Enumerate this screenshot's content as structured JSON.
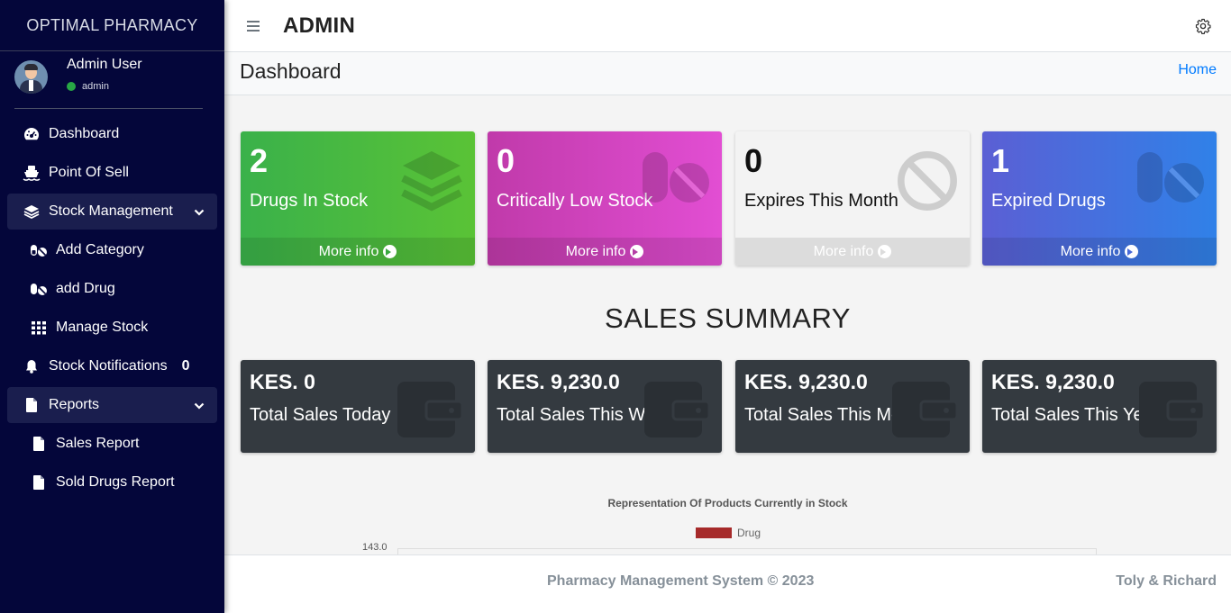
{
  "brand": "OPTIMAL PHARMACY",
  "user": {
    "name": "Admin User",
    "role": "admin",
    "status_color": "#28a745"
  },
  "nav": [
    {
      "label": "Dashboard",
      "icon": "tachometer-icon"
    },
    {
      "label": "Point Of Sell",
      "icon": "ship-icon"
    },
    {
      "label": "Stock Management",
      "icon": "layers-icon",
      "expanded": true
    },
    {
      "label": "Add Category",
      "icon": "capsules-icon"
    },
    {
      "label": "add Drug",
      "icon": "capsules-icon"
    },
    {
      "label": "Manage Stock",
      "icon": "grid-icon"
    },
    {
      "label": "Stock Notifications",
      "icon": "bell-icon",
      "badge": "0"
    },
    {
      "label": "Reports",
      "icon": "file-icon",
      "expanded": true
    },
    {
      "label": "Sales Report",
      "icon": "file-icon"
    },
    {
      "label": "Sold Drugs Report",
      "icon": "file-icon"
    }
  ],
  "topbar": {
    "title": "ADMIN"
  },
  "header": {
    "page_title": "Dashboard",
    "breadcrumb": "Home"
  },
  "stat_boxes": [
    {
      "value": "2",
      "label": "Drugs In Stock",
      "more": "More info",
      "icon": "layers-icon",
      "color": "#3ab14a"
    },
    {
      "value": "0",
      "label": "Critically Low Stock",
      "more": "More info",
      "icon": "capsules-icon",
      "color": "#d444c0"
    },
    {
      "value": "0",
      "label": "Expires This Month",
      "more": "More info",
      "icon": "ban-icon",
      "color": "#f3f3f3"
    },
    {
      "value": "1",
      "label": "Expired Drugs",
      "more": "More info",
      "icon": "capsules-icon",
      "color": "#4470e0"
    }
  ],
  "sales_heading": "SALES SUMMARY",
  "sales_boxes": [
    {
      "amount": "KES. 0",
      "label": "Total Sales Today"
    },
    {
      "amount": "KES. 9,230.0",
      "label": "Total Sales This Week"
    },
    {
      "amount": "KES. 9,230.0",
      "label": "Total Sales This Month"
    },
    {
      "amount": "KES. 9,230.0",
      "label": "Total Sales This Year"
    }
  ],
  "chart": {
    "title": "Representation Of Products Currently in Stock",
    "legend": "Drug",
    "legend_color": "#a62a2a",
    "y_tick_top": "143.0"
  },
  "footer": {
    "copyright": "Pharmacy Management System © 2023",
    "credits": "Toly & Richard"
  }
}
